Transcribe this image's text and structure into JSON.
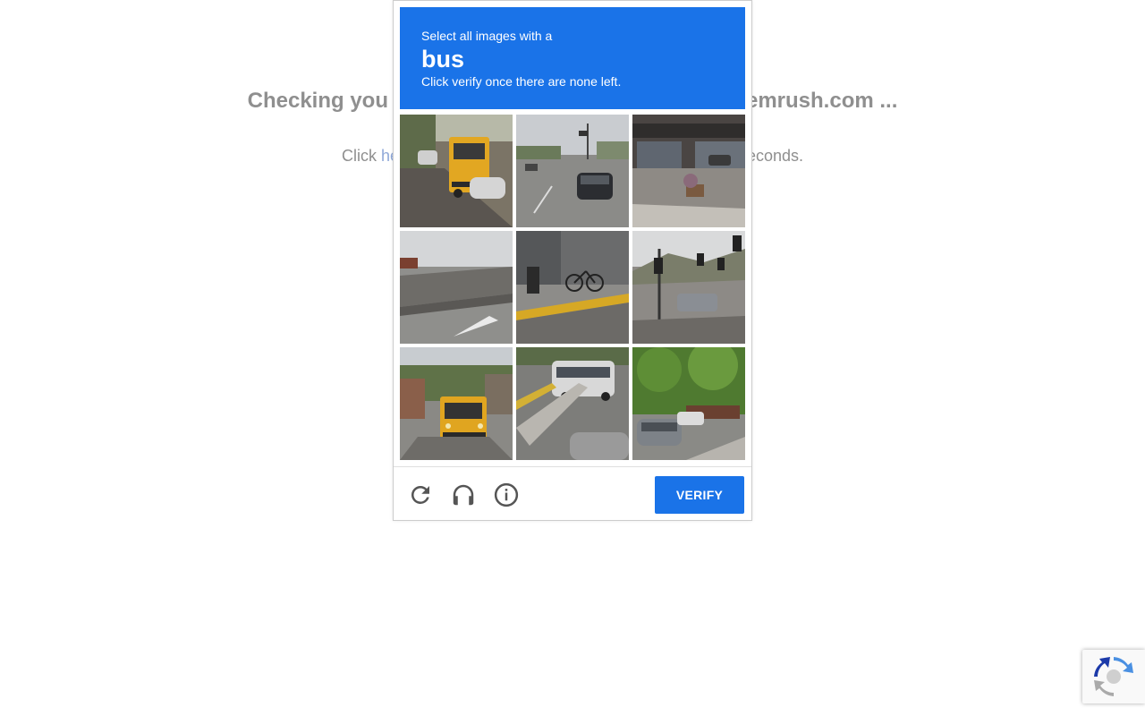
{
  "background": {
    "heading_left": "Checking you",
    "heading_right": "emrush.com ...",
    "sub_prefix": "Click ",
    "sub_link": "he",
    "sub_suffix": "seconds."
  },
  "captcha": {
    "instruction_line1": "Select all images with a",
    "target_word": "bus",
    "instruction_line3": "Click verify once there are none left.",
    "header_color": "#1a73e8",
    "tiles": [
      {
        "id": "tile-1",
        "description": "school bus on street"
      },
      {
        "id": "tile-2",
        "description": "car on road"
      },
      {
        "id": "tile-3",
        "description": "storefront corner"
      },
      {
        "id": "tile-4",
        "description": "overpass road"
      },
      {
        "id": "tile-5",
        "description": "bicycle on sidewalk"
      },
      {
        "id": "tile-6",
        "description": "intersection with traffic lights"
      },
      {
        "id": "tile-7",
        "description": "school bus rear"
      },
      {
        "id": "tile-8",
        "description": "coach bus on highway"
      },
      {
        "id": "tile-9",
        "description": "cars and trees"
      }
    ],
    "footer": {
      "reload_icon": "reload-icon",
      "audio_icon": "headphones-icon",
      "info_icon": "info-icon",
      "verify_label": "VERIFY"
    }
  },
  "badge": {
    "icon": "recaptcha-logo-icon"
  }
}
